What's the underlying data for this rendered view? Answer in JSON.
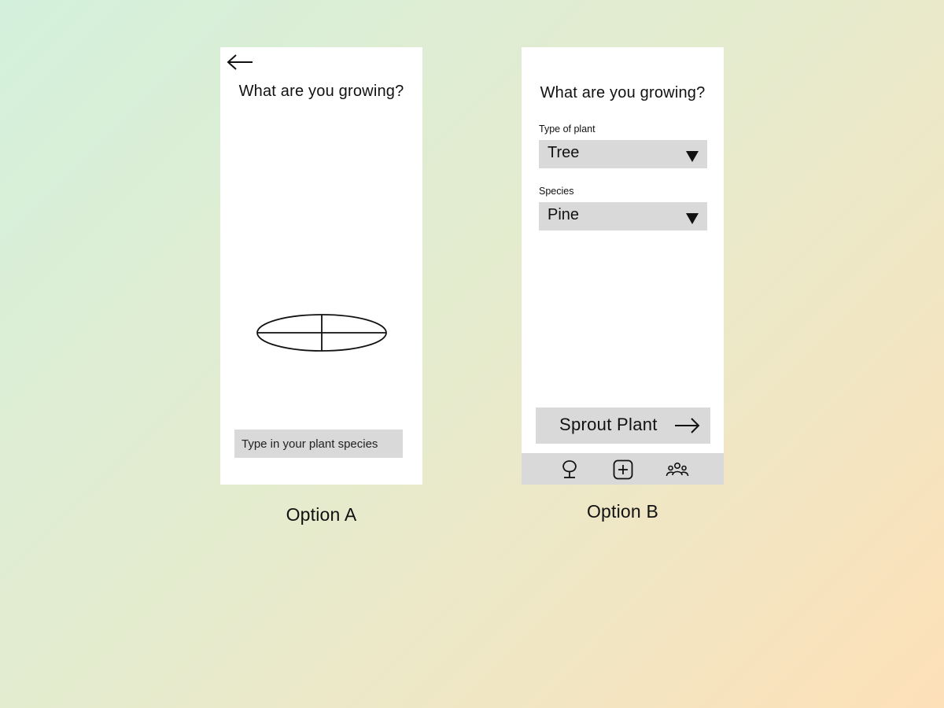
{
  "option_a": {
    "back_icon": "arrow-left-icon",
    "title": "What are you growing?",
    "seed_icon": "seed-icon",
    "species_input": {
      "placeholder": "Type in your plant species",
      "value": ""
    },
    "caption": "Option A"
  },
  "option_b": {
    "title": "What are you growing?",
    "plant_type": {
      "label": "Type of plant",
      "selected": "Tree",
      "icon": "caret-down-icon"
    },
    "species": {
      "label": "Species",
      "selected": "Pine",
      "icon": "caret-down-icon"
    },
    "sprout_button": {
      "label": "Sprout Plant",
      "icon": "arrow-right-icon"
    },
    "nav": [
      {
        "icon": "tree-icon"
      },
      {
        "icon": "add-square-icon"
      },
      {
        "icon": "community-icon"
      }
    ],
    "caption": "Option B"
  },
  "colors": {
    "background_start": "#d3f0dc",
    "background_end": "#fde0b8",
    "screen": "#ffffff",
    "control_fill": "#d9d9d9",
    "text": "#111111"
  }
}
